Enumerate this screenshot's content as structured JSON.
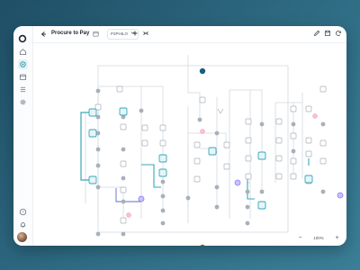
{
  "app": {
    "logo": "app-logo-icon",
    "accent": "#3aa6b9",
    "highlight": "#8b7cf6",
    "alert": "#f39bb1",
    "start_color": "#1b5f7a",
    "end_color": "#c0392b"
  },
  "sidebar": {
    "items": [
      {
        "name": "home",
        "icon": "home-icon",
        "active": false
      },
      {
        "name": "workflows",
        "icon": "workflow-icon",
        "active": true
      },
      {
        "name": "calendar",
        "icon": "calendar-icon",
        "active": false
      },
      {
        "name": "list",
        "icon": "list-icon",
        "active": false
      },
      {
        "name": "settings",
        "icon": "gear-icon",
        "active": false
      }
    ],
    "bottom": [
      {
        "name": "help",
        "icon": "help-icon"
      },
      {
        "name": "notifications",
        "icon": "bell-icon"
      }
    ],
    "avatar": "user-avatar"
  },
  "topbar": {
    "title": "Procure to Pay",
    "version": "P2PHILO",
    "actions": [
      "plus-icon",
      "collapse-icon",
      "edit-icon",
      "save-icon",
      "refresh-icon"
    ]
  },
  "zoom": {
    "value": "100%"
  }
}
